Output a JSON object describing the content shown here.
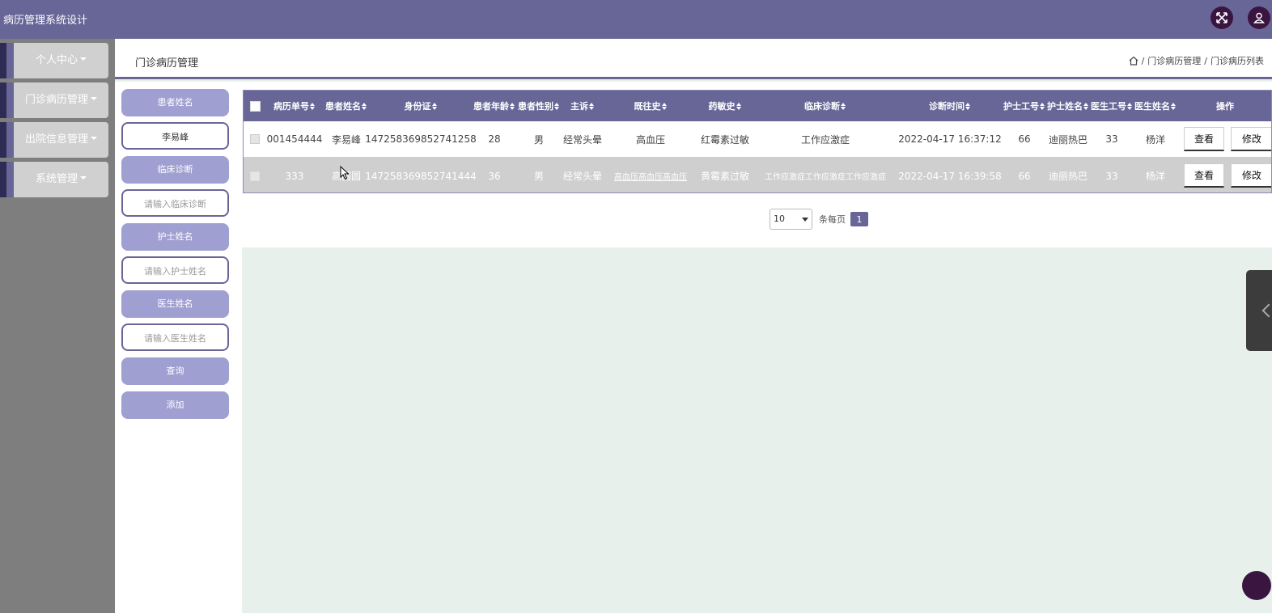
{
  "app": {
    "title": "病历管理系统设计"
  },
  "sidebar": {
    "items": [
      {
        "label": "个人中心"
      },
      {
        "label": "门诊病历管理"
      },
      {
        "label": "出院信息管理"
      },
      {
        "label": "系统管理"
      }
    ]
  },
  "header": {
    "page_title": "门诊病历管理",
    "breadcrumb": [
      "门诊病历管理",
      "门诊病历列表"
    ],
    "separator": "/"
  },
  "search": {
    "patient_name_label": "患者姓名",
    "patient_name_value": "李易峰",
    "diagnosis_label": "临床诊断",
    "diagnosis_placeholder": "请输入临床诊断",
    "nurse_label": "护士姓名",
    "nurse_placeholder": "请输入护士姓名",
    "doctor_label": "医生姓名",
    "doctor_placeholder": "请输入医生姓名",
    "query_label": "查询",
    "add_label": "添加"
  },
  "table": {
    "columns": [
      "病历单号",
      "患者姓名",
      "身份证",
      "患者年龄",
      "患者性别",
      "主诉",
      "既往史",
      "药敏史",
      "临床诊断",
      "诊断时间",
      "护士工号",
      "护士姓名",
      "医生工号",
      "医生姓名",
      "操作"
    ],
    "rows": [
      [
        "001454444",
        "李易峰",
        "147258369852741258",
        "28",
        "男",
        "经常头晕",
        "高血压",
        "红霉素过敏",
        "工作应激症",
        "2022-04-17 16:37:12",
        "66",
        "迪丽热巴",
        "33",
        "杨洋"
      ],
      [
        "333",
        "高圆圆",
        "147258369852741444",
        "36",
        "男",
        "经常头晕",
        "高血压高血压高血压",
        "黄霉素过敏",
        "工作应激症工作应激症工作应激症",
        "2022-04-17 16:39:58",
        "66",
        "迪丽热巴",
        "33",
        "杨洋"
      ]
    ],
    "actions": {
      "view": "查看",
      "edit": "修改"
    }
  },
  "pagination": {
    "page_size": "10",
    "per_page_label": "条每页",
    "current_page": "1"
  },
  "icons": {
    "fullscreen": "fullscreen-icon",
    "user": "user-icon",
    "home": "home-icon",
    "collapse": "chevron-left-icon"
  },
  "colors": {
    "primary": "#686697",
    "light": "#a09fd1",
    "sidebar": "#7e7e7e",
    "dark": "#3a1540"
  }
}
